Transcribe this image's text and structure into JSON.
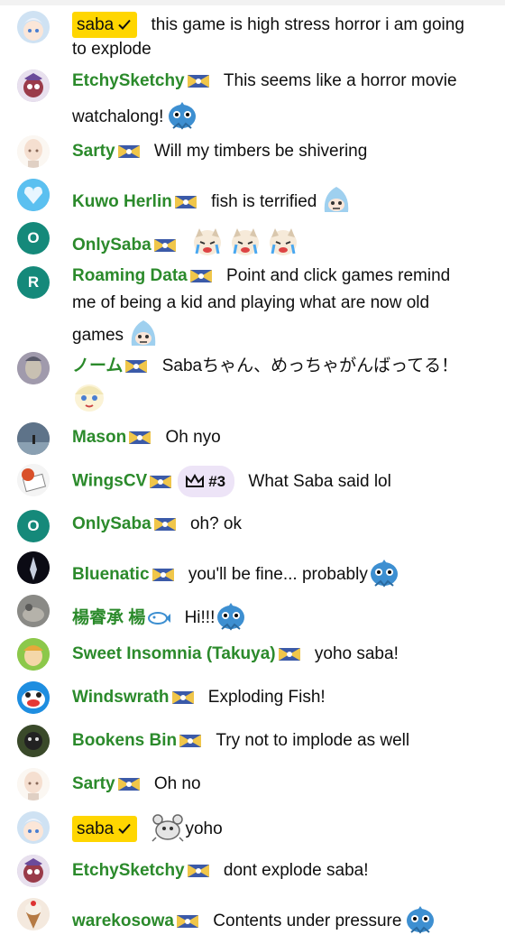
{
  "messages": [
    {
      "author": "saba",
      "owner": true,
      "text": "this game is high stress horror i am going to explode",
      "emotes": []
    },
    {
      "author": "EtchySketchy",
      "text": "This seems like a horror movie watchalong!",
      "emotes": [
        "fish-emote"
      ]
    },
    {
      "author": "Sarty",
      "text": "Will my timbers be shivering",
      "emotes": []
    },
    {
      "author": "Kuwo Herlin",
      "text": "fish is terrified",
      "emotes": [
        "scared-shark-emote"
      ]
    },
    {
      "author": "OnlySaba",
      "avatar_letter": "O",
      "text": "",
      "emotes": [
        "crying-emote",
        "crying-emote",
        "crying-emote"
      ]
    },
    {
      "author": "Roaming Data",
      "avatar_letter": "R",
      "text": "Point and click games remind me of being a kid and playing what are now old games",
      "emotes": [
        "scared-shark-emote"
      ]
    },
    {
      "author": "ノーム",
      "text": "Sabaちゃん、めっちゃがんばってる！",
      "emotes": [
        "cheer-emote"
      ]
    },
    {
      "author": "Mason",
      "text": "Oh nyo",
      "emotes": []
    },
    {
      "author": "WingsCV",
      "gift_rank": "#3",
      "text": "What Saba said lol",
      "emotes": []
    },
    {
      "author": "OnlySaba",
      "avatar_letter": "O",
      "text": "oh? ok",
      "emotes": []
    },
    {
      "author": "Bluenatic",
      "text": "you'll be fine... probably",
      "emotes": [
        "fish-emote"
      ]
    },
    {
      "author": "楊睿承 楊",
      "text": "Hi!!!",
      "emotes": [
        "fish-emote"
      ]
    },
    {
      "author": "Sweet Insomnia (Takuya)",
      "text": "yoho saba!",
      "emotes": []
    },
    {
      "author": "Windswrath",
      "text": "Exploding Fish!",
      "emotes": []
    },
    {
      "author": "Bookens Bin",
      "text": "Try not to implode as well",
      "emotes": []
    },
    {
      "author": "Sarty",
      "text": "Oh no",
      "emotes": []
    },
    {
      "author": "saba",
      "owner": true,
      "text": "yoho",
      "emotes": [
        "crab-emote"
      ]
    },
    {
      "author": "EtchySketchy",
      "text": "dont explode saba!",
      "emotes": []
    },
    {
      "author": "warekosowa",
      "text": "Contents under pressure",
      "emotes": [
        "fish-emote"
      ]
    }
  ],
  "colors": {
    "author": "#2b8a2b",
    "owner_badge": "#ffd600",
    "gift_chip": "#ede4f7",
    "avatar_teal": "#15897a",
    "text": "#0f0f0f"
  }
}
